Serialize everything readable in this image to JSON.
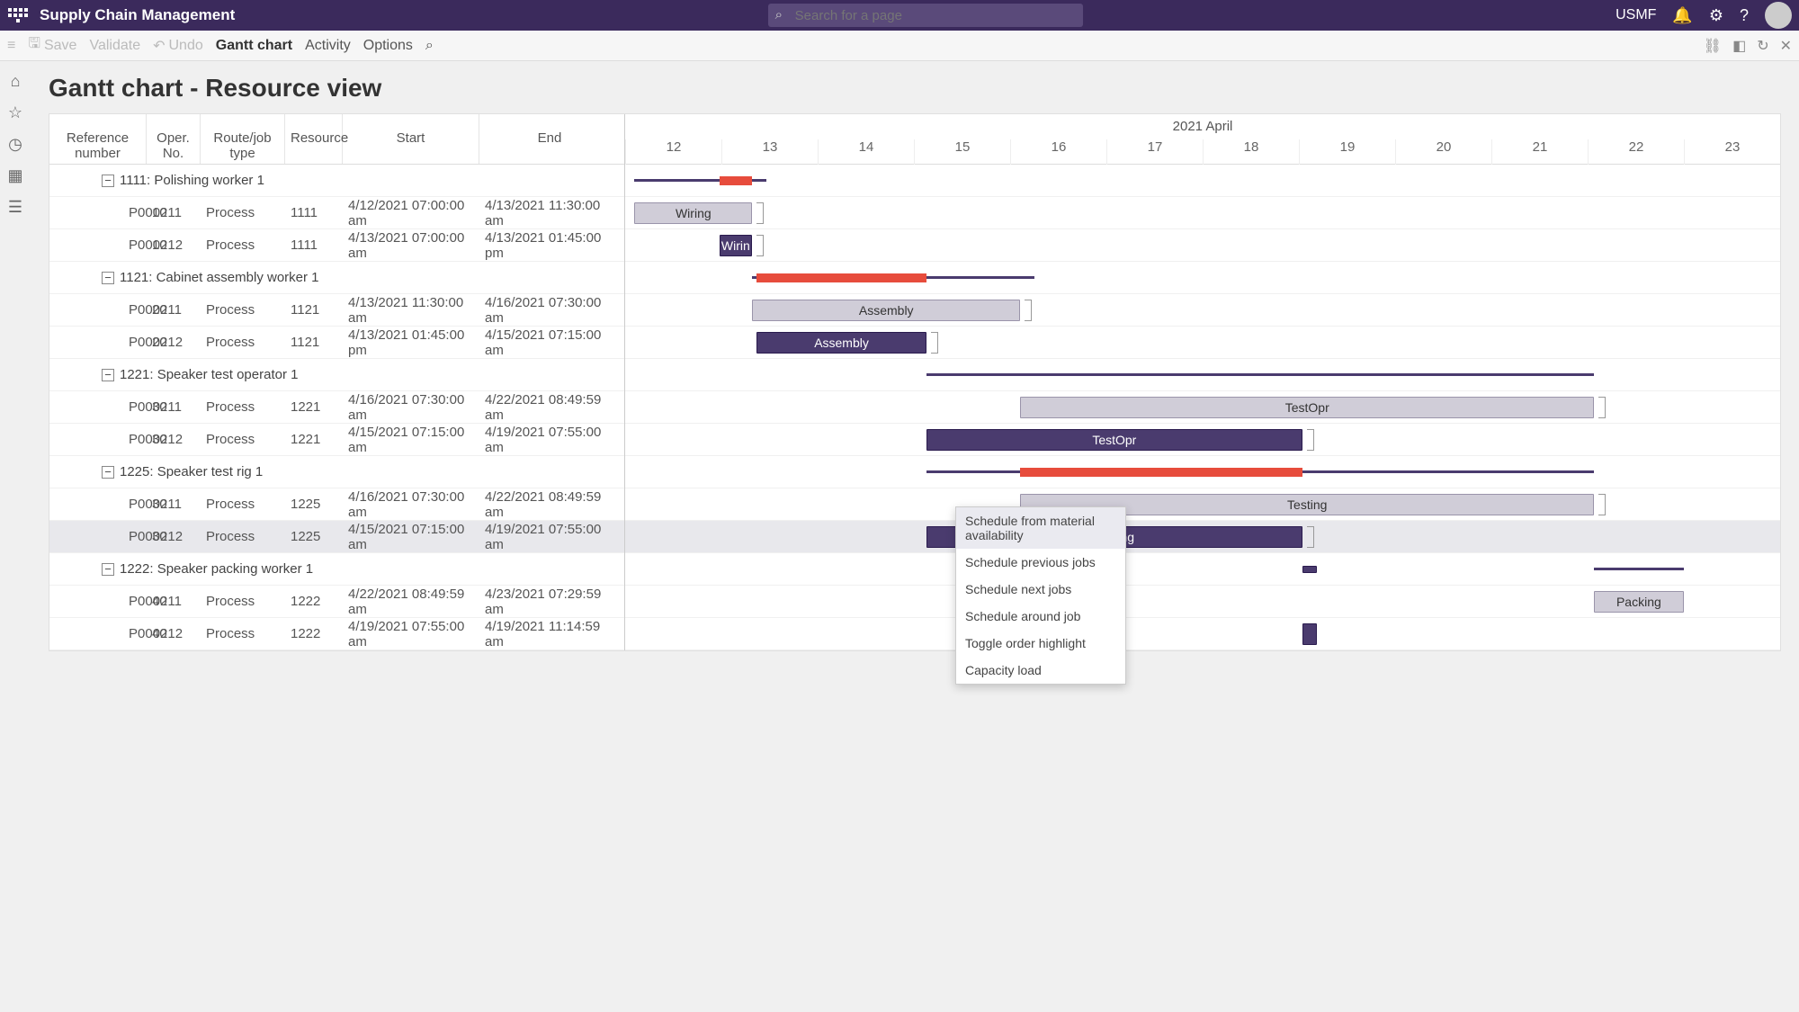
{
  "header": {
    "app_title": "Supply Chain Management",
    "search_placeholder": "Search for a page",
    "company": "USMF"
  },
  "toolbar": {
    "save": "Save",
    "validate": "Validate",
    "undo": "Undo",
    "gantt": "Gantt chart",
    "activity": "Activity",
    "options": "Options"
  },
  "page_title": "Gantt chart - Resource view",
  "grid_headers": {
    "ref": "Reference number",
    "op": "Oper. No.",
    "route": "Route/job type",
    "res": "Resource",
    "start": "Start",
    "end": "End"
  },
  "timeline": {
    "month": "2021 April",
    "days": [
      "12",
      "13",
      "14",
      "15",
      "16",
      "17",
      "18",
      "19",
      "20",
      "21",
      "22",
      "23"
    ]
  },
  "groups": [
    {
      "label": "1111: Polishing worker 1"
    },
    {
      "label": "1121: Cabinet assembly worker 1"
    },
    {
      "label": "1221: Speaker test operator 1"
    },
    {
      "label": "1225: Speaker test rig 1"
    },
    {
      "label": "1222: Speaker packing worker 1"
    }
  ],
  "rows": [
    {
      "ref": "P000211",
      "op": "10",
      "route": "Process",
      "res": "1111",
      "start": "4/12/2021 07:00:00 am",
      "end": "4/13/2021 11:30:00 am"
    },
    {
      "ref": "P000212",
      "op": "10",
      "route": "Process",
      "res": "1111",
      "start": "4/13/2021 07:00:00 am",
      "end": "4/13/2021 01:45:00 pm"
    },
    {
      "ref": "P000211",
      "op": "20",
      "route": "Process",
      "res": "1121",
      "start": "4/13/2021 11:30:00 am",
      "end": "4/16/2021 07:30:00 am"
    },
    {
      "ref": "P000212",
      "op": "20",
      "route": "Process",
      "res": "1121",
      "start": "4/13/2021 01:45:00 pm",
      "end": "4/15/2021 07:15:00 am"
    },
    {
      "ref": "P000211",
      "op": "30",
      "route": "Process",
      "res": "1221",
      "start": "4/16/2021 07:30:00 am",
      "end": "4/22/2021 08:49:59 am"
    },
    {
      "ref": "P000212",
      "op": "30",
      "route": "Process",
      "res": "1221",
      "start": "4/15/2021 07:15:00 am",
      "end": "4/19/2021 07:55:00 am"
    },
    {
      "ref": "P000211",
      "op": "30",
      "route": "Process",
      "res": "1225",
      "start": "4/16/2021 07:30:00 am",
      "end": "4/22/2021 08:49:59 am"
    },
    {
      "ref": "P000212",
      "op": "30",
      "route": "Process",
      "res": "1225",
      "start": "4/15/2021 07:15:00 am",
      "end": "4/19/2021 07:55:00 am"
    },
    {
      "ref": "P000211",
      "op": "40",
      "route": "Process",
      "res": "1222",
      "start": "4/22/2021 08:49:59 am",
      "end": "4/23/2021 07:29:59 am"
    },
    {
      "ref": "P000212",
      "op": "40",
      "route": "Process",
      "res": "1222",
      "start": "4/19/2021 07:55:00 am",
      "end": "4/19/2021 11:14:59 am"
    }
  ],
  "bars": {
    "wiring1": "Wiring",
    "wiring2": "Wirin",
    "assembly1": "Assembly",
    "assembly2": "Assembly",
    "testopr1": "TestOpr",
    "testopr2": "TestOpr",
    "testing1": "Testing",
    "testing2": "Testing",
    "packing": "Packing"
  },
  "context_menu": [
    "Schedule from material availability",
    "Schedule previous jobs",
    "Schedule next jobs",
    "Schedule around job",
    "Toggle order highlight",
    "Capacity load"
  ],
  "chart_data": {
    "type": "gantt",
    "x_axis": {
      "start": "2021-04-12",
      "end": "2021-04-23",
      "label": "2021 April"
    },
    "resources": [
      {
        "id": "1111",
        "name": "Polishing worker 1",
        "capacity_segments": [
          {
            "start": "4/12",
            "end": "4/13.5",
            "overload": false
          },
          {
            "start": "4/13",
            "end": "4/13.3",
            "overload": true
          }
        ]
      },
      {
        "id": "1121",
        "name": "Cabinet assembly worker 1",
        "capacity_segments": [
          {
            "start": "4/13",
            "end": "4/16.3",
            "overload": false
          },
          {
            "start": "4/13.2",
            "end": "4/15.2",
            "overload": true
          }
        ]
      },
      {
        "id": "1221",
        "name": "Speaker test operator 1",
        "capacity_segments": [
          {
            "start": "4/15",
            "end": "4/22.3",
            "overload": false
          }
        ]
      },
      {
        "id": "1225",
        "name": "Speaker test rig 1",
        "capacity_segments": [
          {
            "start": "4/15",
            "end": "4/22.3",
            "overload": false
          },
          {
            "start": "4/16.3",
            "end": "4/19.3",
            "overload": true
          }
        ]
      },
      {
        "id": "1222",
        "name": "Speaker packing worker 1",
        "capacity_segments": [
          {
            "start": "4/22.3",
            "end": "4/23.3",
            "overload": false
          }
        ]
      }
    ],
    "jobs": [
      {
        "ref": "P000211",
        "op": 10,
        "res": "1111",
        "start": "4/12/2021 07:00",
        "end": "4/13/2021 11:30",
        "label": "Wiring",
        "status": "scheduled"
      },
      {
        "ref": "P000212",
        "op": 10,
        "res": "1111",
        "start": "4/13/2021 07:00",
        "end": "4/13/2021 13:45",
        "label": "Wiring",
        "status": "firm"
      },
      {
        "ref": "P000211",
        "op": 20,
        "res": "1121",
        "start": "4/13/2021 11:30",
        "end": "4/16/2021 07:30",
        "label": "Assembly",
        "status": "scheduled"
      },
      {
        "ref": "P000212",
        "op": 20,
        "res": "1121",
        "start": "4/13/2021 13:45",
        "end": "4/15/2021 07:15",
        "label": "Assembly",
        "status": "firm"
      },
      {
        "ref": "P000211",
        "op": 30,
        "res": "1221",
        "start": "4/16/2021 07:30",
        "end": "4/22/2021 08:49",
        "label": "TestOpr",
        "status": "scheduled"
      },
      {
        "ref": "P000212",
        "op": 30,
        "res": "1221",
        "start": "4/15/2021 07:15",
        "end": "4/19/2021 07:55",
        "label": "TestOpr",
        "status": "firm"
      },
      {
        "ref": "P000211",
        "op": 30,
        "res": "1225",
        "start": "4/16/2021 07:30",
        "end": "4/22/2021 08:49",
        "label": "Testing",
        "status": "scheduled"
      },
      {
        "ref": "P000212",
        "op": 30,
        "res": "1225",
        "start": "4/15/2021 07:15",
        "end": "4/19/2021 07:55",
        "label": "Testing",
        "status": "firm"
      },
      {
        "ref": "P000211",
        "op": 40,
        "res": "1222",
        "start": "4/22/2021 08:49",
        "end": "4/23/2021 07:29",
        "label": "Packing",
        "status": "scheduled"
      },
      {
        "ref": "P000212",
        "op": 40,
        "res": "1222",
        "start": "4/19/2021 07:55",
        "end": "4/19/2021 11:14",
        "label": "Packing",
        "status": "firm"
      }
    ]
  }
}
